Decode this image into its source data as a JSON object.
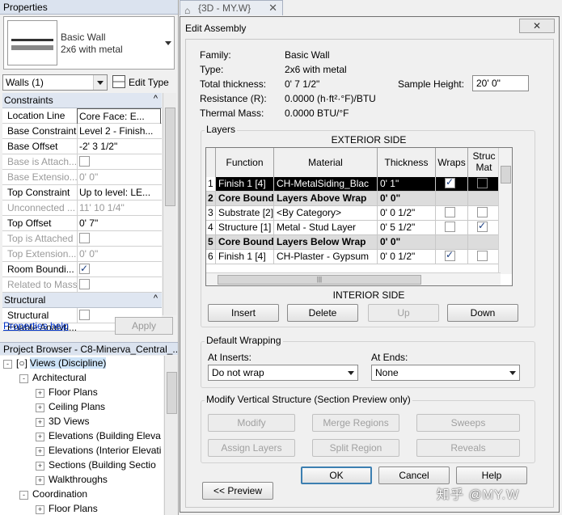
{
  "properties": {
    "title": "Properties",
    "type_family": "Basic Wall",
    "type_name": "2x6 with metal",
    "selector": "Walls (1)",
    "edit_type": "Edit Type",
    "sections": [
      {
        "name": "Constraints",
        "chevron": "^"
      },
      {
        "name": "Structural",
        "chevron": "^"
      }
    ],
    "rows": [
      {
        "key": "Location Line",
        "value": "Core Face: E..."
      },
      {
        "key": "Base Constraint",
        "value": "Level 2 - Finish..."
      },
      {
        "key": "Base Offset",
        "value": "-2'  3 1/2\""
      },
      {
        "key": "Base is Attach...",
        "value": ""
      },
      {
        "key": "Base Extensio...",
        "value": "0'  0\""
      },
      {
        "key": "Top Constraint",
        "value": "Up to level: LE..."
      },
      {
        "key": "Unconnected ...",
        "value": "11'  10 1/4\""
      },
      {
        "key": "Top Offset",
        "value": "0'  7\""
      },
      {
        "key": "Top is Attached",
        "value": ""
      },
      {
        "key": "Top Extension...",
        "value": "0'  0\""
      },
      {
        "key": "Room Boundi...",
        "value": ""
      },
      {
        "key": "Related to Mass",
        "value": ""
      },
      {
        "key": "Structural",
        "value": ""
      },
      {
        "key": "Enable Analyti...",
        "value": ""
      }
    ],
    "help_link": "Properties help",
    "apply": "Apply"
  },
  "project_browser": {
    "title": "Project Browser - C8-Minerva_Central_...",
    "nodes": [
      {
        "label": "Views (Discipline)",
        "box": "-"
      },
      {
        "label": "Architectural",
        "box": "-"
      },
      {
        "label": "Floor Plans",
        "box": "+"
      },
      {
        "label": "Ceiling Plans",
        "box": "+"
      },
      {
        "label": "3D Views",
        "box": "+"
      },
      {
        "label": "Elevations (Building Eleva",
        "box": "+"
      },
      {
        "label": "Elevations (Interior Elevati",
        "box": "+"
      },
      {
        "label": "Sections (Building Sectio",
        "box": "+"
      },
      {
        "label": "Walkthroughs",
        "box": "+"
      },
      {
        "label": "Coordination",
        "box": "-"
      },
      {
        "label": "Floor Plans",
        "box": "+"
      }
    ]
  },
  "view_tab": {
    "label": "{3D - MY.W}",
    "close": "✕"
  },
  "dialog": {
    "title": "Edit Assembly",
    "close": "✕",
    "info": [
      {
        "label": "Family:",
        "value": "Basic Wall"
      },
      {
        "label": "Type:",
        "value": "2x6 with metal"
      },
      {
        "label": "Total thickness:",
        "value": "0'  7 1/2\""
      },
      {
        "label": "Resistance (R):",
        "value": "0.0000 (h·ft²·°F)/BTU"
      },
      {
        "label": "Thermal Mass:",
        "value": "0.0000 BTU/°F"
      }
    ],
    "sample_height_label": "Sample Height:",
    "sample_height_value": "20'  0\"",
    "layers": {
      "group_title": "Layers",
      "exterior": "EXTERIOR SIDE",
      "interior": "INTERIOR SIDE",
      "columns": [
        "Function",
        "Material",
        "Thickness",
        "Wraps",
        "Struc Mat"
      ],
      "rows": [
        {
          "num": "1",
          "function": "Finish 1 [4]",
          "material": "CH-MetalSiding_Blac",
          "thickness": "0'  1\""
        },
        {
          "num": "2",
          "function": "Core Bound",
          "material": "Layers Above Wrap",
          "thickness": "0'  0\""
        },
        {
          "num": "3",
          "function": "Substrate [2]",
          "material": "<By Category>",
          "thickness": "0'  0 1/2\""
        },
        {
          "num": "4",
          "function": "Structure [1]",
          "material": "Metal - Stud Layer",
          "thickness": "0'  5 1/2\""
        },
        {
          "num": "5",
          "function": "Core Bound",
          "material": "Layers Below Wrap",
          "thickness": "0'  0\""
        },
        {
          "num": "6",
          "function": "Finish 1 [4]",
          "material": "CH-Plaster - Gypsum",
          "thickness": "0'  0 1/2\""
        }
      ],
      "insert": "Insert",
      "delete": "Delete",
      "up": "Up",
      "down": "Down"
    },
    "wrapping": {
      "group_title": "Default Wrapping",
      "at_inserts_label": "At Inserts:",
      "at_inserts_value": "Do not wrap",
      "at_ends_label": "At Ends:",
      "at_ends_value": "None"
    },
    "vertical": {
      "group_title": "Modify Vertical Structure (Section Preview only)",
      "modify": "Modify",
      "merge": "Merge Regions",
      "sweeps": "Sweeps",
      "assign": "Assign Layers",
      "split": "Split Region",
      "reveals": "Reveals"
    },
    "ok": "OK",
    "cancel": "Cancel",
    "help": "Help",
    "preview": "<< Preview"
  },
  "watermark": "知乎 @MY.W"
}
